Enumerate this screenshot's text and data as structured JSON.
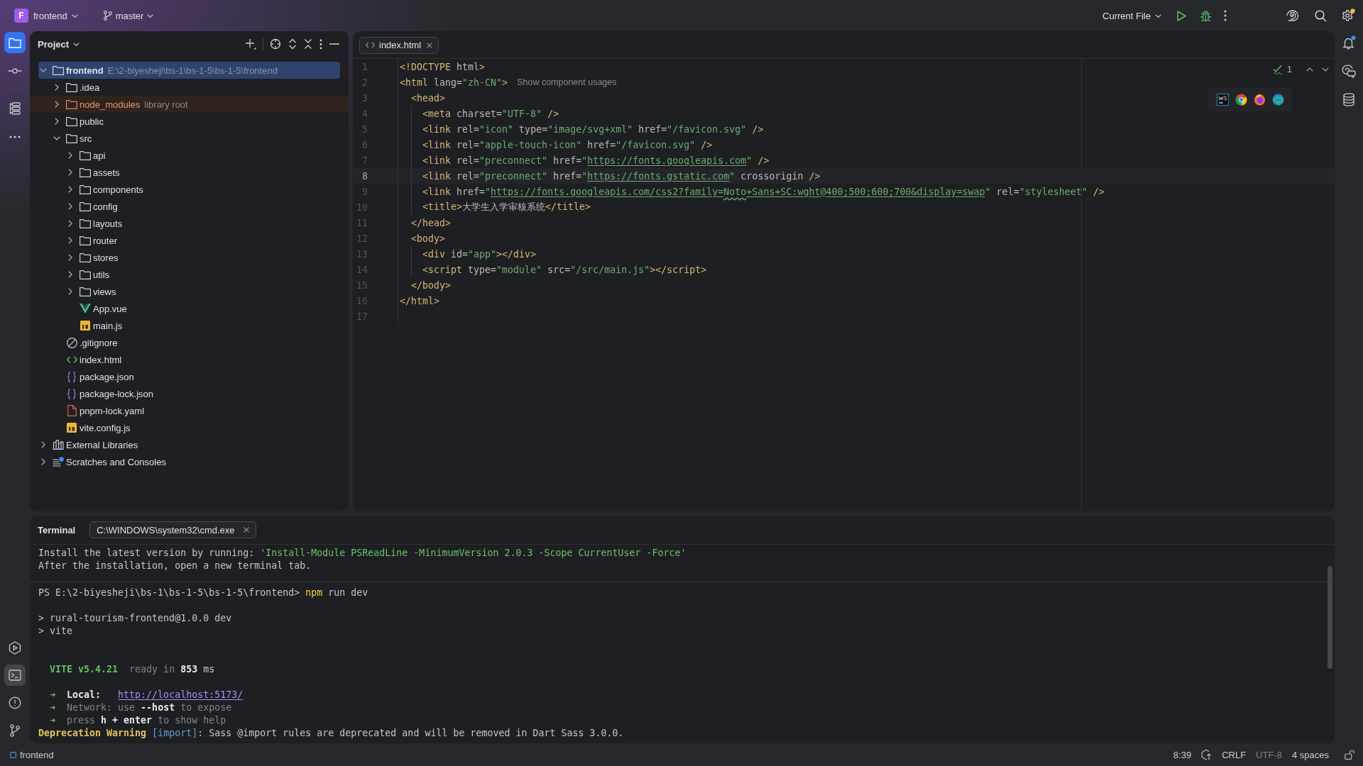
{
  "title_bar": {
    "project": {
      "initial": "F",
      "name": "frontend"
    },
    "branch": "master",
    "run_config": "Current File",
    "settings": {
      "badge": true
    }
  },
  "left_strip": {
    "top": [
      [
        {
          "kind": "project",
          "selected": true,
          "focused": true
        },
        {
          "kind": "commit",
          "selected": false,
          "focused": false
        }
      ],
      [
        {
          "kind": "structure",
          "selected": false,
          "focused": false
        },
        {
          "kind": "more",
          "selected": false,
          "focused": false
        }
      ]
    ],
    "bottom": [
      {
        "kind": "services",
        "selected": false,
        "focused": false
      },
      {
        "kind": "terminal",
        "selected": true,
        "focused": false
      },
      {
        "kind": "problems",
        "selected": false,
        "focused": false
      },
      {
        "kind": "git",
        "selected": false,
        "focused": false
      }
    ]
  },
  "right_strip": [
    {
      "kind": "notifications",
      "badge": true
    },
    {
      "kind": "ai_chat",
      "badge": false
    },
    {
      "kind": "database",
      "badge": false
    }
  ],
  "project_panel": {
    "title": "Project",
    "tree": [
      {
        "name": "frontend",
        "kind": "module",
        "hint": "E:\\2-biyesheji\\bs-1\\bs-1-5\\bs-1-5\\frontend",
        "expanded": true,
        "selected": true,
        "children": [
          {
            "name": ".idea",
            "kind": "folder",
            "expanded": false,
            "selected": false
          },
          {
            "name": "node_modules",
            "kind": "library_folder",
            "hint": "library root",
            "expanded": false,
            "selected": false
          },
          {
            "name": "public",
            "kind": "folder",
            "expanded": false,
            "selected": false
          },
          {
            "name": "src",
            "kind": "folder",
            "expanded": true,
            "selected": false,
            "children": [
              {
                "name": "api",
                "kind": "folder",
                "expanded": false,
                "selected": false
              },
              {
                "name": "assets",
                "kind": "folder",
                "expanded": false,
                "selected": false
              },
              {
                "name": "components",
                "kind": "folder",
                "expanded": false,
                "selected": false
              },
              {
                "name": "config",
                "kind": "folder",
                "expanded": false,
                "selected": false
              },
              {
                "name": "layouts",
                "kind": "folder",
                "expanded": false,
                "selected": false
              },
              {
                "name": "router",
                "kind": "folder",
                "expanded": false,
                "selected": false
              },
              {
                "name": "stores",
                "kind": "folder",
                "expanded": false,
                "selected": false
              },
              {
                "name": "utils",
                "kind": "folder",
                "expanded": false,
                "selected": false
              },
              {
                "name": "views",
                "kind": "folder",
                "expanded": false,
                "selected": false
              },
              {
                "name": "App.vue",
                "kind": "vue",
                "selected": false
              },
              {
                "name": "main.js",
                "kind": "js",
                "selected": false
              }
            ]
          },
          {
            "name": ".gitignore",
            "kind": "ignore",
            "selected": false
          },
          {
            "name": "index.html",
            "kind": "html",
            "selected": false
          },
          {
            "name": "package.json",
            "kind": "json",
            "selected": false
          },
          {
            "name": "package-lock.json",
            "kind": "json",
            "selected": false
          },
          {
            "name": "pnpm-lock.yaml",
            "kind": "yaml",
            "selected": false
          },
          {
            "name": "vite.config.js",
            "kind": "js",
            "selected": false
          }
        ]
      },
      {
        "name": "External Libraries",
        "kind": "libraries",
        "expanded": false,
        "selected": false
      },
      {
        "name": "Scratches and Consoles",
        "kind": "scratches",
        "expanded": false,
        "selected": false
      }
    ]
  },
  "editor": {
    "tabs": [
      {
        "name": "index.html",
        "selected": true
      }
    ],
    "inspection": {
      "count": "1"
    },
    "lines": [
      {
        "number": "1",
        "current": false,
        "tokens": [
          {
            "text": "<!DOCTYPE",
            "kind": "tag"
          },
          {
            "text": " html",
            "kind": "attr"
          },
          {
            "text": ">",
            "kind": "tag"
          }
        ]
      },
      {
        "number": "2",
        "current": false,
        "tokens": [
          {
            "text": "<html",
            "kind": "tag"
          },
          {
            "text": " lang=",
            "kind": "attr"
          },
          {
            "text": "\"zh-CN\"",
            "kind": "value"
          },
          {
            "text": ">",
            "kind": "tag"
          }
        ],
        "hint": "Show component usages",
        "children": [
          {
            "number": "3",
            "current": false,
            "tokens": [
              {
                "text": "<head>",
                "kind": "tag"
              }
            ],
            "children": [
              {
                "number": "4",
                "current": false,
                "tokens": [
                  {
                    "text": "<meta",
                    "kind": "tag"
                  },
                  {
                    "text": " charset=",
                    "kind": "attr"
                  },
                  {
                    "text": "\"UTF-8\"",
                    "kind": "value"
                  },
                  {
                    "text": " />",
                    "kind": "tag"
                  }
                ]
              },
              {
                "number": "5",
                "current": false,
                "tokens": [
                  {
                    "text": "<link",
                    "kind": "tag"
                  },
                  {
                    "text": " rel=",
                    "kind": "attr"
                  },
                  {
                    "text": "\"icon\"",
                    "kind": "value"
                  },
                  {
                    "text": " type=",
                    "kind": "attr"
                  },
                  {
                    "text": "\"image/svg+xml\"",
                    "kind": "value"
                  },
                  {
                    "text": " href=",
                    "kind": "attr"
                  },
                  {
                    "text": "\"/favicon.svg\"",
                    "kind": "value"
                  },
                  {
                    "text": " />",
                    "kind": "tag"
                  }
                ]
              },
              {
                "number": "6",
                "current": false,
                "tokens": [
                  {
                    "text": "<link",
                    "kind": "tag"
                  },
                  {
                    "text": " rel=",
                    "kind": "attr"
                  },
                  {
                    "text": "\"apple-touch-icon\"",
                    "kind": "value"
                  },
                  {
                    "text": " href=",
                    "kind": "attr"
                  },
                  {
                    "text": "\"/favicon.svg\"",
                    "kind": "value"
                  },
                  {
                    "text": " />",
                    "kind": "tag"
                  }
                ]
              },
              {
                "number": "7",
                "current": false,
                "tokens": [
                  {
                    "text": "<link",
                    "kind": "tag"
                  },
                  {
                    "text": " rel=",
                    "kind": "attr"
                  },
                  {
                    "text": "\"preconnect\"",
                    "kind": "value"
                  },
                  {
                    "text": " href=",
                    "kind": "attr"
                  },
                  {
                    "text": "\"",
                    "kind": "value"
                  },
                  {
                    "text": "https://fonts.googleapis.com",
                    "kind": "link"
                  },
                  {
                    "text": "\"",
                    "kind": "value"
                  },
                  {
                    "text": " />",
                    "kind": "tag"
                  }
                ]
              },
              {
                "number": "8",
                "current": true,
                "tokens": [
                  {
                    "text": "<link",
                    "kind": "tag"
                  },
                  {
                    "text": " rel=",
                    "kind": "attr"
                  },
                  {
                    "text": "\"preconnect\"",
                    "kind": "value"
                  },
                  {
                    "text": " href=",
                    "kind": "attr"
                  },
                  {
                    "text": "\"",
                    "kind": "value"
                  },
                  {
                    "text": "https://fonts.gstatic.com",
                    "kind": "link"
                  },
                  {
                    "text": "\"",
                    "kind": "value"
                  },
                  {
                    "text": " crossorigin",
                    "kind": "attr"
                  },
                  {
                    "text": " />",
                    "kind": "tag"
                  }
                ]
              },
              {
                "number": "9",
                "current": false,
                "tokens": [
                  {
                    "text": "<link",
                    "kind": "tag"
                  },
                  {
                    "text": " href=",
                    "kind": "attr"
                  },
                  {
                    "text": "\"",
                    "kind": "value"
                  },
                  {
                    "text": "https://fonts.googleapis.com/css2?family=",
                    "kind": "link"
                  },
                  {
                    "text": "Noto",
                    "kind": "typo"
                  },
                  {
                    "text": "+Sans+SC:wght@400;500;600;700&display=swap",
                    "kind": "link"
                  },
                  {
                    "text": "\"",
                    "kind": "value"
                  },
                  {
                    "text": " rel=",
                    "kind": "attr"
                  },
                  {
                    "text": "\"stylesheet\"",
                    "kind": "value"
                  },
                  {
                    "text": " />",
                    "kind": "tag"
                  }
                ]
              },
              {
                "number": "10",
                "current": false,
                "tokens": [
                  {
                    "text": "<title>",
                    "kind": "tag"
                  },
                  {
                    "text": "大学生入学审核系统",
                    "kind": "text"
                  },
                  {
                    "text": "</title>",
                    "kind": "tag"
                  }
                ]
              }
            ]
          },
          {
            "number": "11",
            "current": false,
            "tokens": [
              {
                "text": "</head>",
                "kind": "tag"
              }
            ]
          },
          {
            "number": "12",
            "current": false,
            "tokens": [
              {
                "text": "<body>",
                "kind": "tag"
              }
            ],
            "children": [
              {
                "number": "13",
                "current": false,
                "tokens": [
                  {
                    "text": "<div",
                    "kind": "tag"
                  },
                  {
                    "text": " id=",
                    "kind": "attr"
                  },
                  {
                    "text": "\"app\"",
                    "kind": "value"
                  },
                  {
                    "text": "></div>",
                    "kind": "tag"
                  }
                ]
              },
              {
                "number": "14",
                "current": false,
                "tokens": [
                  {
                    "text": "<script",
                    "kind": "tag"
                  },
                  {
                    "text": " type=",
                    "kind": "attr"
                  },
                  {
                    "text": "\"module\"",
                    "kind": "value"
                  },
                  {
                    "text": " src=",
                    "kind": "attr"
                  },
                  {
                    "text": "\"/src/main.js\"",
                    "kind": "value"
                  },
                  {
                    "text": "></script>",
                    "kind": "tag"
                  }
                ]
              }
            ]
          },
          {
            "number": "15",
            "current": false,
            "tokens": [
              {
                "text": "</body>",
                "kind": "tag"
              }
            ]
          }
        ]
      },
      {
        "number": "16",
        "current": false,
        "tokens": [
          {
            "text": "</html>",
            "kind": "tag"
          }
        ]
      },
      {
        "number": "17",
        "current": false
      }
    ]
  },
  "terminal": {
    "title": "Terminal",
    "tabs": [
      {
        "label": "C:\\WINDOWS\\system32\\cmd.exe",
        "selected": true
      }
    ],
    "blocks": [
      {
        "lines": [
          {
            "kind": "text",
            "segments": [
              {
                "text": "Install the latest version by running: ",
                "kind": "plain"
              },
              {
                "text": "'Install-Module PSReadLine -MinimumVersion 2.0.3 -Scope CurrentUser -Force'",
                "kind": "string"
              }
            ]
          },
          {
            "kind": "text",
            "segments": [
              {
                "text": "After the installation, open a new terminal tab.",
                "kind": "plain"
              }
            ]
          }
        ]
      },
      {
        "lines": [
          {
            "kind": "text",
            "segments": [
              {
                "text": "PS E:\\2-biyesheji\\bs-1\\bs-1-5\\bs-1-5\\frontend> ",
                "kind": "plain"
              },
              {
                "text": "npm",
                "kind": "command"
              },
              {
                "text": " run dev",
                "kind": "plain"
              }
            ]
          },
          {
            "kind": "blank"
          },
          {
            "kind": "text",
            "segments": [
              {
                "text": "> rural-tourism-frontend@1.0.0 dev",
                "kind": "plain"
              }
            ]
          },
          {
            "kind": "text",
            "segments": [
              {
                "text": "> vite",
                "kind": "plain"
              }
            ]
          },
          {
            "kind": "blank"
          },
          {
            "kind": "blank"
          },
          {
            "kind": "indented",
            "segments": [
              {
                "text": "VITE v5.4.21",
                "kind": "vite"
              },
              {
                "text": "  ready in ",
                "kind": "dim"
              },
              {
                "text": "853",
                "kind": "bold"
              },
              {
                "text": " ms",
                "kind": "plain"
              }
            ]
          },
          {
            "kind": "blank"
          },
          {
            "kind": "indented",
            "segments": [
              {
                "text": "➜",
                "kind": "arrow"
              },
              {
                "text": "  Local:   ",
                "kind": "bold"
              },
              {
                "text": "http://localhost:5173/",
                "kind": "link"
              }
            ]
          },
          {
            "kind": "indented",
            "segments": [
              {
                "text": "➜",
                "kind": "arrow"
              },
              {
                "text": "  Network: use ",
                "kind": "dim"
              },
              {
                "text": "--host",
                "kind": "bold"
              },
              {
                "text": " to expose",
                "kind": "dim"
              }
            ]
          },
          {
            "kind": "indented",
            "segments": [
              {
                "text": "➜",
                "kind": "arrow"
              },
              {
                "text": "  press ",
                "kind": "dim"
              },
              {
                "text": "h + enter",
                "kind": "bold"
              },
              {
                "text": " to show help",
                "kind": "dim"
              }
            ]
          },
          {
            "kind": "text",
            "segments": [
              {
                "text": "Deprecation Warning",
                "kind": "warning"
              },
              {
                "text": " [import]",
                "kind": "blue"
              },
              {
                "text": ": Sass @import rules are deprecated and will be removed in Dart Sass 3.0.0.",
                "kind": "plain"
              }
            ]
          }
        ]
      }
    ]
  },
  "status_bar": {
    "breadcrumb": "frontend",
    "position": "8:39",
    "line_separator": "CRLF",
    "encoding": {
      "text": "UTF-8",
      "disabled": true
    },
    "indentation": "4 spaces"
  }
}
